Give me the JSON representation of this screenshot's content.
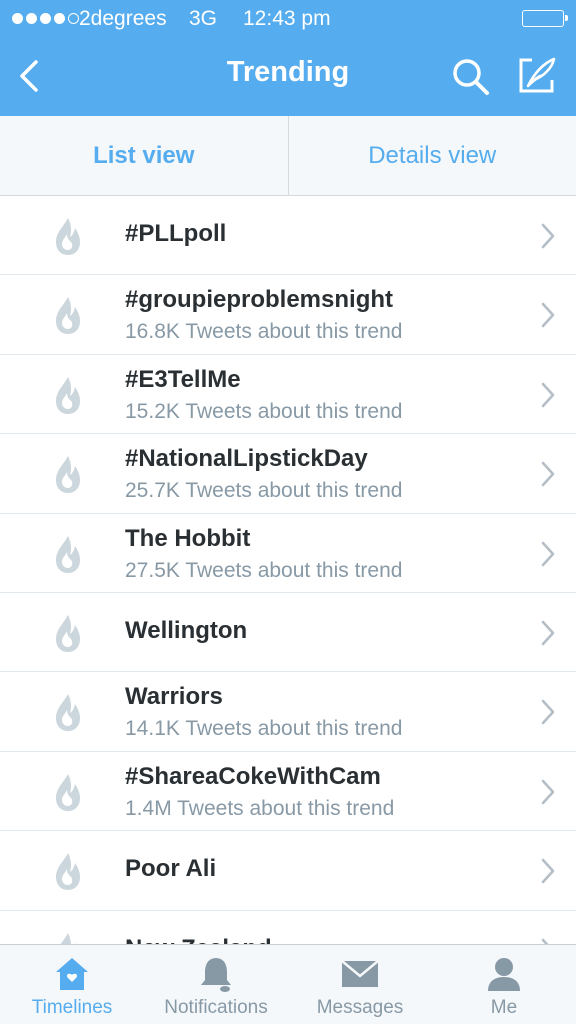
{
  "status_bar": {
    "carrier": "2degrees",
    "network": "3G",
    "time": "12:43 pm",
    "signal_bars_filled": 4,
    "signal_bars_total": 5
  },
  "navbar": {
    "title": "Trending",
    "icons": [
      "back-chevron-icon",
      "search-icon",
      "compose-icon"
    ]
  },
  "tabs": {
    "list_view": "List view",
    "details_view": "Details view",
    "selected": "List view"
  },
  "trends": [
    {
      "name": "#PLLpoll",
      "tweets": ""
    },
    {
      "name": "#groupieproblemsnight",
      "tweets": "16.8K Tweets about this trend"
    },
    {
      "name": "#E3TellMe",
      "tweets": "15.2K Tweets about this trend"
    },
    {
      "name": "#NationalLipstickDay",
      "tweets": "25.7K Tweets about this trend"
    },
    {
      "name": "The Hobbit",
      "tweets": "27.5K Tweets about this trend"
    },
    {
      "name": "Wellington",
      "tweets": ""
    },
    {
      "name": "Warriors",
      "tweets": "14.1K Tweets about this trend"
    },
    {
      "name": "#ShareaCokeWithCam",
      "tweets": "1.4M Tweets about this trend"
    },
    {
      "name": "Poor Ali",
      "tweets": ""
    },
    {
      "name": "New Zealand",
      "tweets": ""
    }
  ],
  "tabbar": {
    "items": [
      {
        "label": "Timelines",
        "icon": "home-icon"
      },
      {
        "label": "Notifications",
        "icon": "bell-icon"
      },
      {
        "label": "Messages",
        "icon": "envelope-icon"
      },
      {
        "label": "Me",
        "icon": "person-icon"
      }
    ],
    "active": "Timelines"
  },
  "colors": {
    "brand": "#55acee",
    "text": "#292f33",
    "secondary_text": "#8899a6",
    "icon_gray": "#ccd6dd"
  }
}
